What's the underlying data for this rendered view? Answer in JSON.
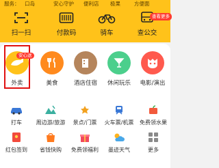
{
  "top_chips": [
    "服务：",
    "口岛",
    "安心守护",
    "便利店",
    "极果",
    "方便面"
  ],
  "quick_actions": [
    {
      "label": "扫一扫",
      "icon": "scan-icon"
    },
    {
      "label": "付款码",
      "icon": "barcode-icon"
    },
    {
      "label": "骑车",
      "icon": "bike-icon"
    },
    {
      "label": "查公交",
      "icon": "bus-icon"
    }
  ],
  "quick_badge": "查看更多",
  "main_services": [
    {
      "label": "外卖",
      "icon": "takeaway-icon",
      "color": "#ffc21a",
      "badge": "安心送"
    },
    {
      "label": "美食",
      "icon": "food-icon",
      "color": "#ff8a1e"
    },
    {
      "label": "酒店住宿",
      "icon": "hotel-icon",
      "color": "#b5855c"
    },
    {
      "label": "休闲玩乐",
      "icon": "cocktail-icon",
      "color": "#4ccf8c"
    },
    {
      "label": "电影/演出",
      "icon": "movie-icon",
      "color": "#ff5a4e"
    }
  ],
  "row2": [
    {
      "label": "打车",
      "icon": "car-icon"
    },
    {
      "label": "周边游/旅游",
      "icon": "travel-icon"
    },
    {
      "label": "景点/门票",
      "icon": "ticket-icon"
    },
    {
      "label": "火车票/机票",
      "icon": "train-icon"
    },
    {
      "label": "免费领水果",
      "icon": "fruit-icon"
    }
  ],
  "row3": [
    {
      "label": "红包签到",
      "icon": "red-packet-icon"
    },
    {
      "label": "省钱快购",
      "icon": "shopping-icon"
    },
    {
      "label": "免费领福利",
      "icon": "gift-icon"
    },
    {
      "label": "墨迹天气",
      "icon": "weather-icon"
    },
    {
      "label": "更多",
      "icon": "more-icon"
    }
  ],
  "colors": {
    "brand_yellow": "#ffc21a",
    "highlight_red": "#e01010",
    "badge_red": "#ff3b30"
  }
}
